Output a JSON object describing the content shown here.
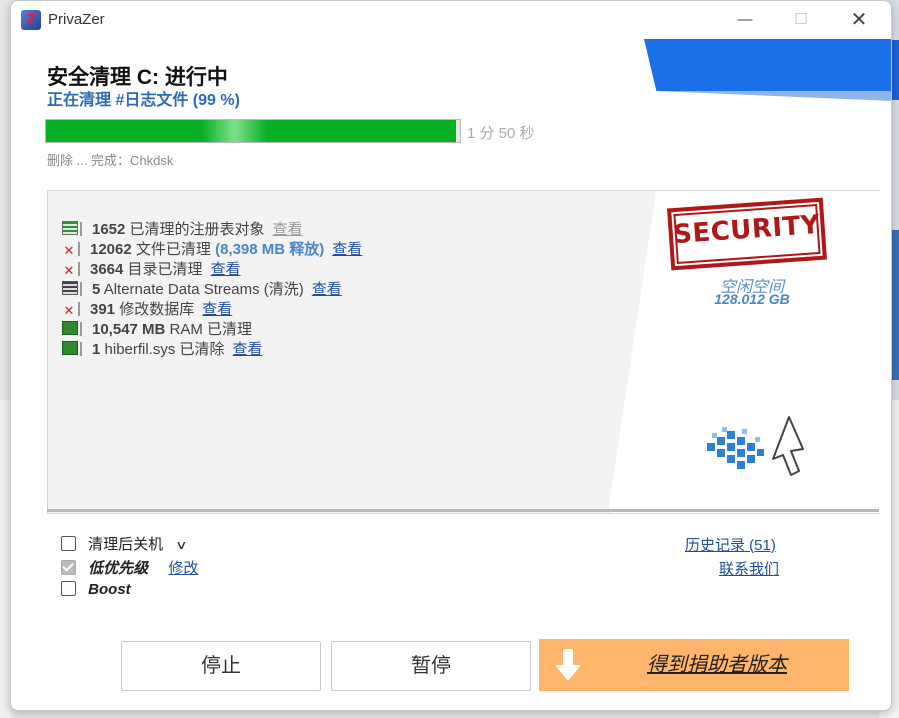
{
  "window": {
    "app_title": "PrivaZer"
  },
  "header": {
    "title_prefix": "安全清理",
    "title_drive": "C:",
    "title_suffix": "进行中",
    "subtitle": "正在清理 #日志文件 (99 %)"
  },
  "progress": {
    "value_percent": 99,
    "eta": "1 分 50 秒",
    "status": "删除 ... 完成：Chkdsk"
  },
  "stats": [
    {
      "icon": "registry-icon",
      "number": "1652",
      "text": "已清理的注册表对象",
      "highlight": "",
      "link": "查看",
      "link_style": "gray"
    },
    {
      "icon": "red-x-icon",
      "number": "12062",
      "text": "文件已清理",
      "highlight": "(8,398 MB 释放)",
      "link": "查看",
      "link_style": "blue"
    },
    {
      "icon": "red-x-icon",
      "number": "3664",
      "text": "目录已清理",
      "highlight": "",
      "link": "查看",
      "link_style": "blue"
    },
    {
      "icon": "data-stream-icon",
      "number": "5",
      "text": "Alternate Data Streams (清洗)",
      "highlight": "",
      "link": "查看",
      "link_style": "blue"
    },
    {
      "icon": "red-x-icon",
      "number": "391",
      "text": "修改数据库",
      "highlight": "",
      "link": "查看",
      "link_style": "blue"
    },
    {
      "icon": "ram-icon",
      "number": "10,547 MB",
      "text": "RAM 已清理",
      "highlight": "",
      "link": "",
      "link_style": ""
    },
    {
      "icon": "ram-icon",
      "number": "1",
      "text": "hiberfil.sys 已清除",
      "highlight": "",
      "link": "查看",
      "link_style": "blue"
    }
  ],
  "security": {
    "stamp": "SECURITY",
    "free_space_label": "空闲空间",
    "free_space_value": "128.012 GB"
  },
  "options": {
    "shutdown_label": "清理后关机",
    "shutdown_checked": false,
    "low_priority_label": "低优先级",
    "low_priority_checked": true,
    "low_priority_link": "修改",
    "boost_label": "Boost",
    "boost_checked": false,
    "history_link": "历史记录 (51)",
    "contact_link": "联系我们"
  },
  "buttons": {
    "stop": "停止",
    "pause": "暂停",
    "donor": "得到捐助者版本"
  },
  "colors": {
    "progress_green": "#06b025",
    "accent_blue": "#2d6bb8",
    "donor_orange": "#ffb56b",
    "stamp_red": "#b01818"
  }
}
